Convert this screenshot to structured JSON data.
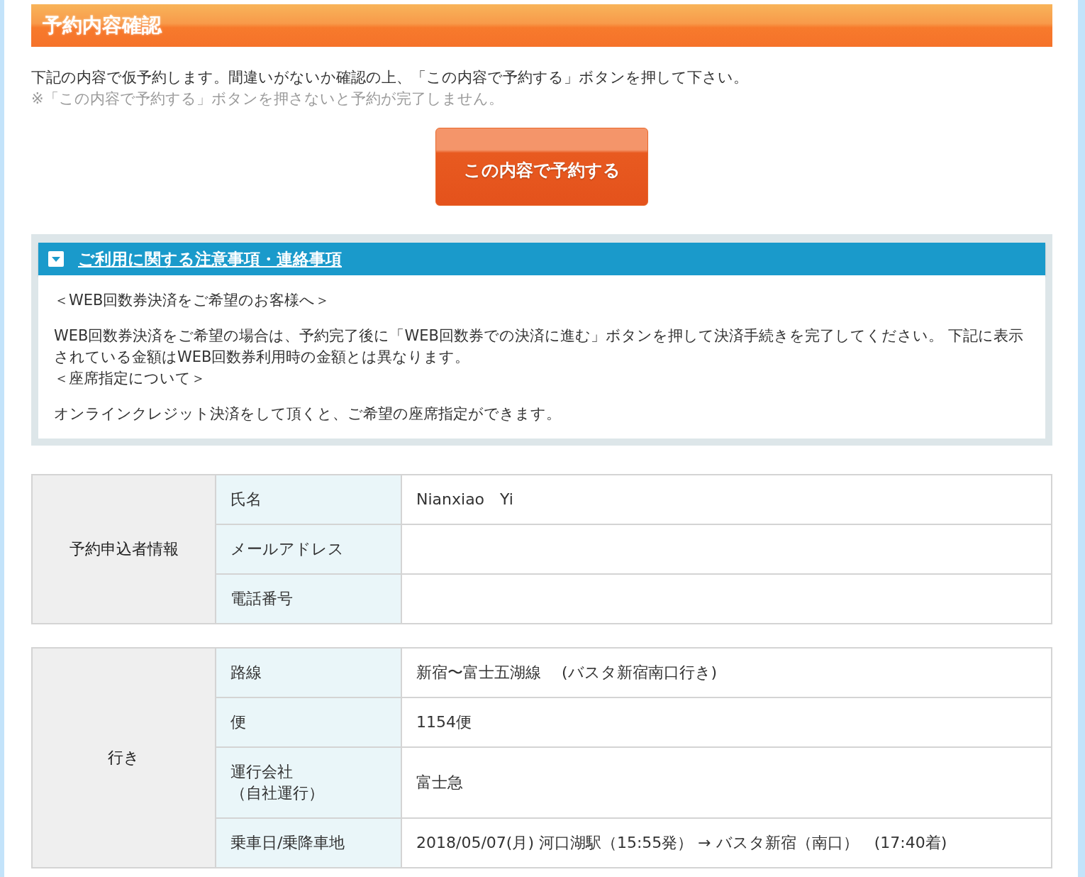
{
  "header": {
    "title": "予約内容確認"
  },
  "intro": {
    "message": "下記の内容で仮予約します。間違いがないか確認の上、「この内容で予約する」ボタンを押して下さい。",
    "warning": "※「この内容で予約する」ボタンを押さないと予約が完了しません。"
  },
  "confirm_button": {
    "label": "この内容で予約する"
  },
  "notice_panel": {
    "title": "ご利用に関する注意事項・連絡事項",
    "expanded": true,
    "paragraphs": [
      {
        "kind": "heading",
        "text": "＜WEB回数券決済をご希望のお客様へ＞"
      },
      {
        "kind": "body",
        "text": "WEB回数券決済をご希望の場合は、予約完了後に「WEB回数券での決済に進む」ボタンを押して決済手続きを完了してください。 下記に表示されている金額はWEB回数券利用時の金額とは異なります。"
      },
      {
        "kind": "heading",
        "text": "＜座席指定について＞"
      },
      {
        "kind": "body",
        "text": "オンラインクレジット決済をして頂くと、ご希望の座席指定ができます。"
      }
    ]
  },
  "tables": [
    {
      "group": "予約申込者情報",
      "rows": [
        {
          "label": "氏名",
          "value": "Nianxiao　Yi"
        },
        {
          "label": "メールアドレス"
        },
        {
          "label": "電話番号"
        }
      ]
    },
    {
      "group": "行き",
      "rows": [
        {
          "label": "路線",
          "value": "新宿〜富士五湖線　 (バスタ新宿南口行き)"
        },
        {
          "label": "便",
          "value": "1154便"
        },
        {
          "label": "運行会社",
          "label_note": "（自社運行）",
          "value": "富士急"
        },
        {
          "label": "乗車日/乗降車地",
          "value": "2018/05/07(月) 河口湖駅（15:55発） → バスタ新宿（南口）　(17:40着)"
        }
      ]
    }
  ]
}
